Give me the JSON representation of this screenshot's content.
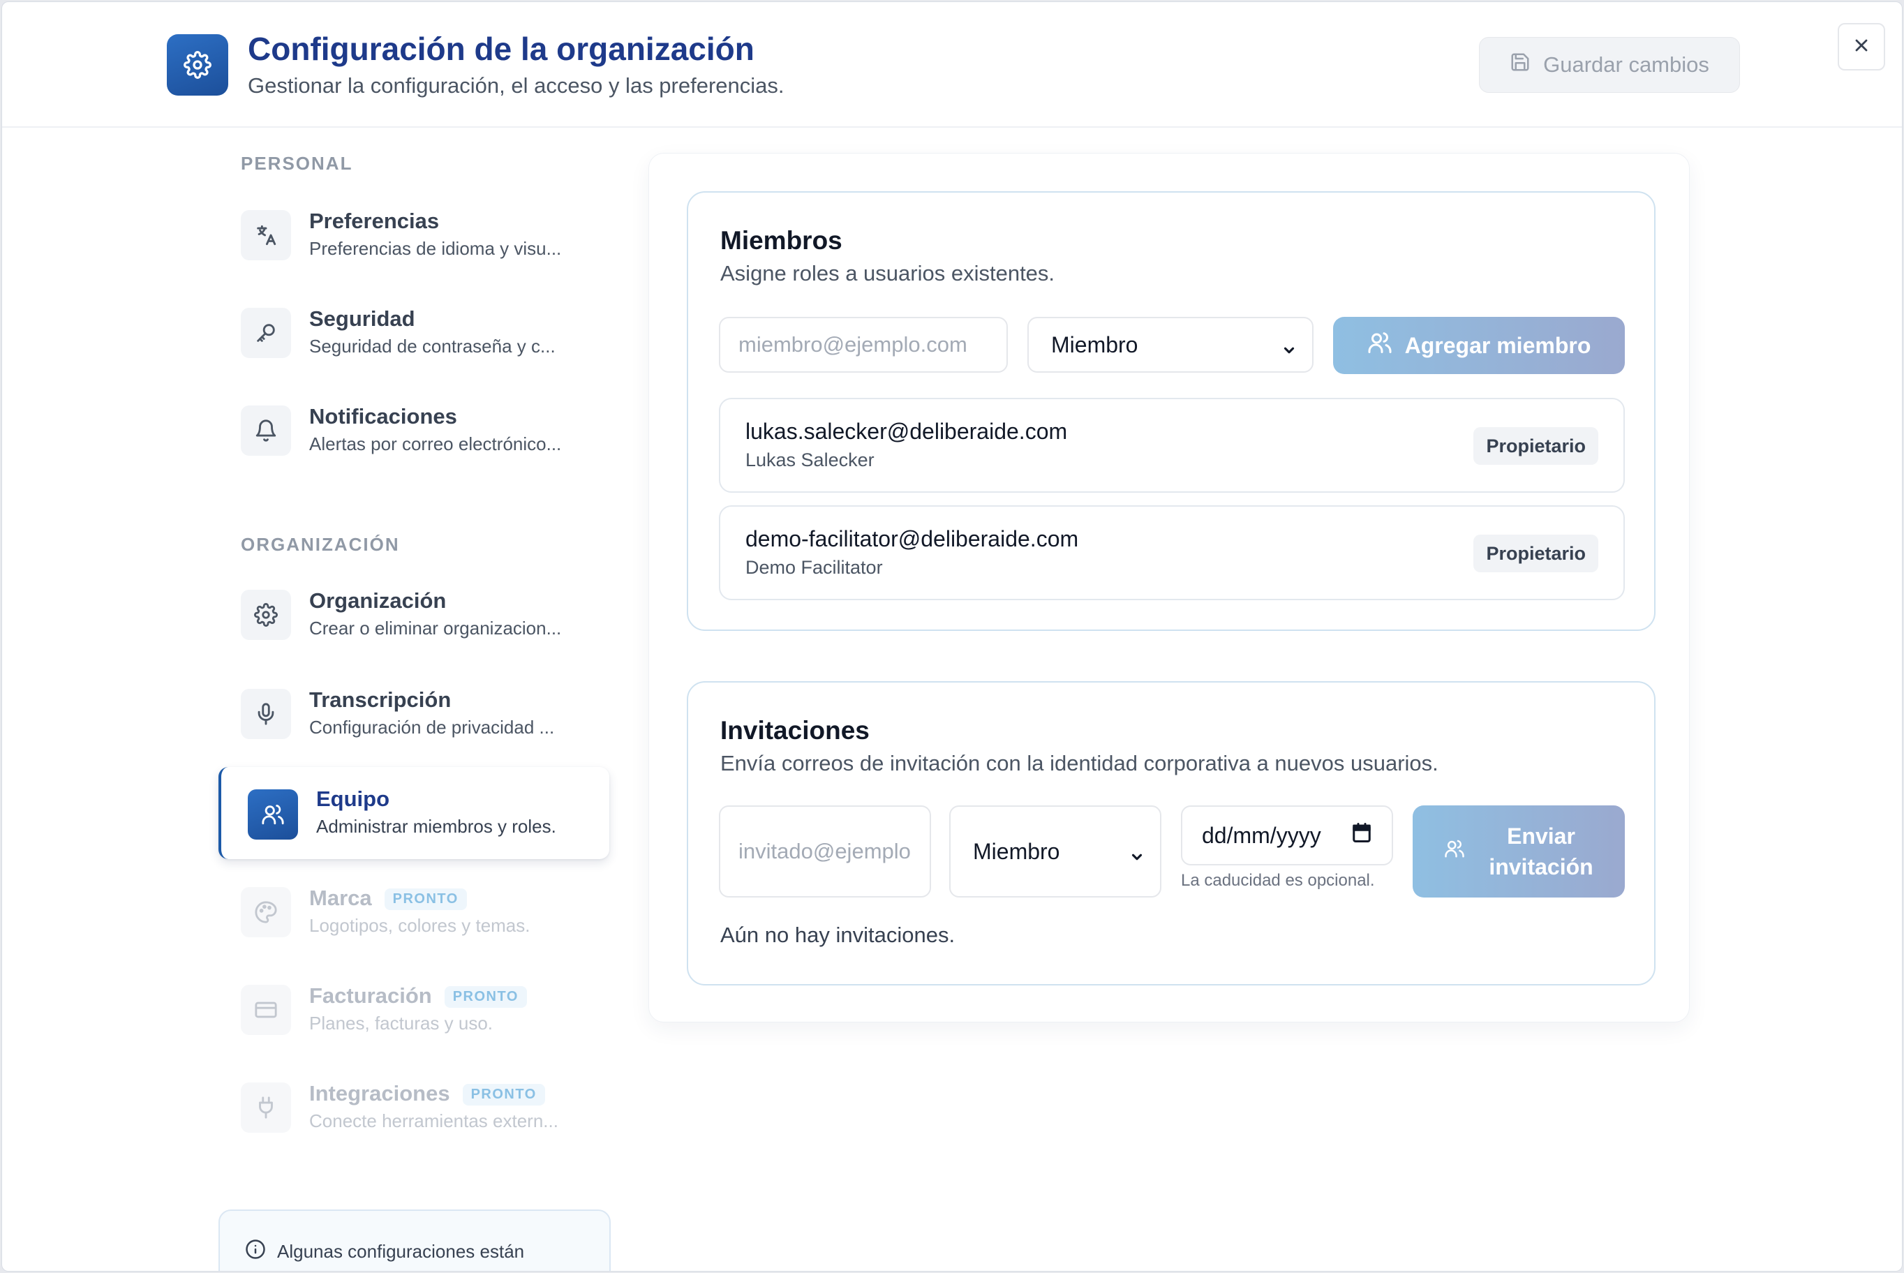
{
  "header": {
    "title": "Configuración de la organización",
    "subtitle": "Gestionar la configuración, el acceso y las preferencias.",
    "save_label": "Guardar cambios"
  },
  "sidebar": {
    "personal_label": "PERSONAL",
    "org_label": "ORGANIZACIÓN",
    "items": [
      {
        "title": "Preferencias",
        "desc": "Preferencias de idioma y visu..."
      },
      {
        "title": "Seguridad",
        "desc": "Seguridad de contraseña y c..."
      },
      {
        "title": "Notificaciones",
        "desc": "Alertas por correo electrónico..."
      },
      {
        "title": "Organización",
        "desc": "Crear o eliminar organizacion..."
      },
      {
        "title": "Transcripción",
        "desc": "Configuración de privacidad ..."
      },
      {
        "title": "Equipo",
        "desc": "Administrar miembros y roles."
      },
      {
        "title": "Marca",
        "desc": "Logotipos, colores y temas.",
        "badge": "PRONTO"
      },
      {
        "title": "Facturación",
        "desc": "Planes, facturas y uso.",
        "badge": "PRONTO"
      },
      {
        "title": "Integraciones",
        "desc": "Conecte herramientas extern...",
        "badge": "PRONTO"
      }
    ],
    "note": "Algunas configuraciones están"
  },
  "members": {
    "title": "Miembros",
    "subtitle": "Asigne roles a usuarios existentes.",
    "email_placeholder": "miembro@ejemplo.com",
    "role_value": "Miembro",
    "add_label": "Agregar miembro",
    "list": [
      {
        "email": "lukas.salecker@deliberaide.com",
        "name": "Lukas Salecker",
        "role": "Propietario"
      },
      {
        "email": "demo-facilitator@deliberaide.com",
        "name": "Demo Facilitator",
        "role": "Propietario"
      }
    ]
  },
  "invitations": {
    "title": "Invitaciones",
    "subtitle": "Envía correos de invitación con la identidad corporativa a nuevos usuarios.",
    "email_placeholder": "invitado@ejemplo.com",
    "role_value": "Miembro",
    "date_placeholder": "dd/mm/yyyy",
    "expiry_hint": "La caducidad es opcional.",
    "send_label_line1": "Enviar",
    "send_label_line2": "invitación",
    "empty": "Aún no hay invitaciones."
  },
  "colors": {
    "accent": "#1c4f9a",
    "title": "#1e3a8a",
    "soon_badge": "#8ac0e4"
  }
}
